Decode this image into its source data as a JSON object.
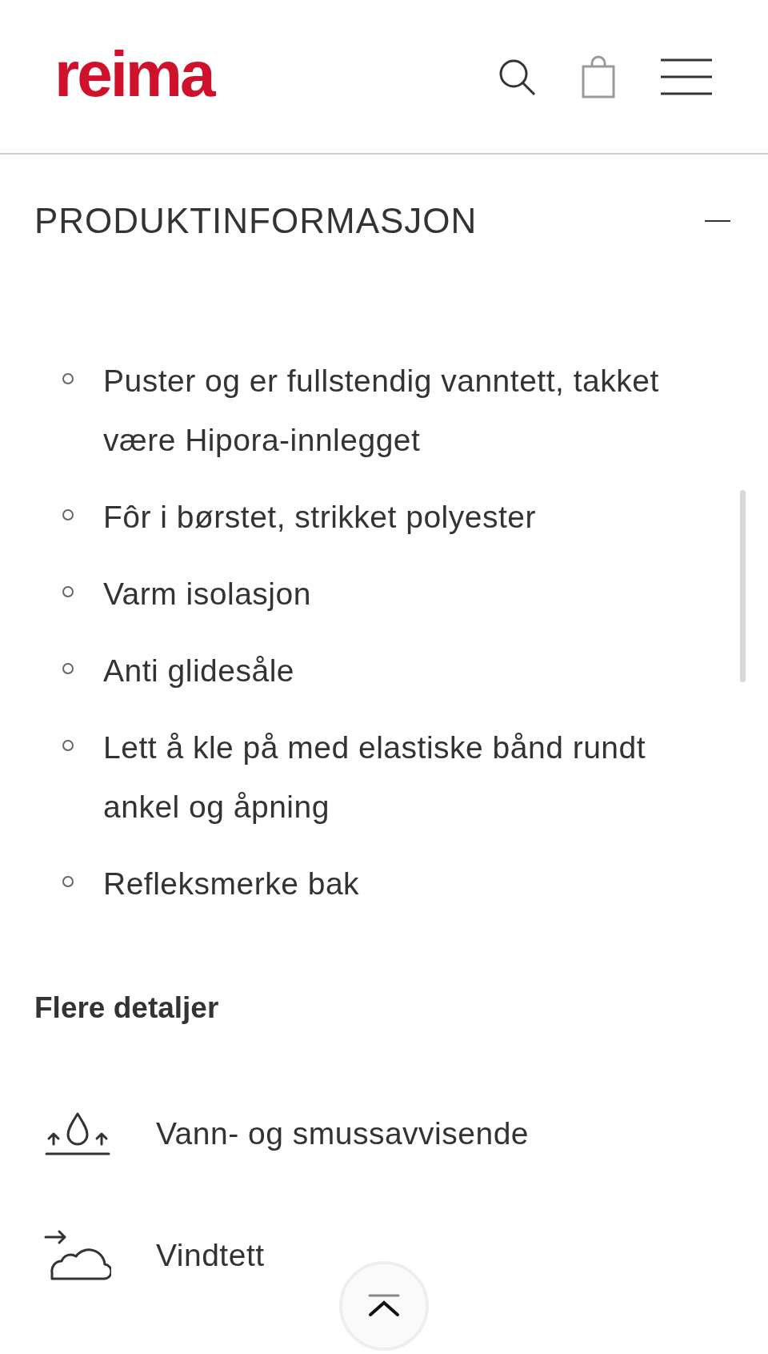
{
  "header": {
    "logo": "reima"
  },
  "section": {
    "title": "PRODUKTINFORMASJON",
    "expanded": true,
    "features": [
      "Puster og er fullstendig vanntett, takket være Hipora-innlegget",
      "Fôr i børstet, strikket polyester",
      "Varm isolasjon",
      "Anti glidesåle",
      "Lett å kle på med elastiske bånd rundt ankel og åpning",
      "Refleksmerke bak"
    ],
    "details_title": "Flere detaljer",
    "details": [
      {
        "kind": "water",
        "label": "Vann- og smussavvisende"
      },
      {
        "kind": "wind",
        "label": "Vindtett"
      }
    ]
  }
}
